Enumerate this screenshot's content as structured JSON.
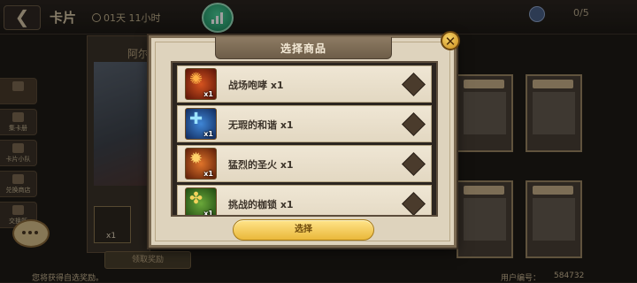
{
  "header": {
    "back_glyph": "❮",
    "title": "卡片",
    "timer": "01天 11小时",
    "counter": "0/5"
  },
  "side_tabs": [
    "",
    "集卡册",
    "卡片小队",
    "兑换商店",
    "交换所"
  ],
  "left_panel": {
    "title": "阿尔",
    "mini_item_qty": "x1",
    "claim_label": "领取奖励"
  },
  "footer": {
    "hint": "您将获得自选奖励。",
    "user_label": "用户编号：",
    "user_id": "584732"
  },
  "modal": {
    "title": "选择商品",
    "close_glyph": "✕",
    "select_label": "选择",
    "items": [
      {
        "name": "战场咆哮 x1",
        "qty": "x1",
        "icon": "roar-badge-icon",
        "glyph": "✺",
        "bg": "#9a2a18",
        "glyph_color": "#ffb347"
      },
      {
        "name": "无瑕的和谐 x1",
        "qty": "x1",
        "icon": "harmony-badge-icon",
        "glyph": "✚",
        "bg": "#1f4f9a",
        "glyph_color": "#9be3ff"
      },
      {
        "name": "猛烈的圣火 x1",
        "qty": "x1",
        "icon": "holy-fire-badge-icon",
        "glyph": "✹",
        "bg": "#a8461a",
        "glyph_color": "#ffd36b"
      },
      {
        "name": "挑战的枷锁 x1",
        "qty": "x1",
        "icon": "shackle-badge-icon",
        "glyph": "✤",
        "bg": "#3d7d2a",
        "glyph_color": "#f2d35c"
      }
    ]
  }
}
